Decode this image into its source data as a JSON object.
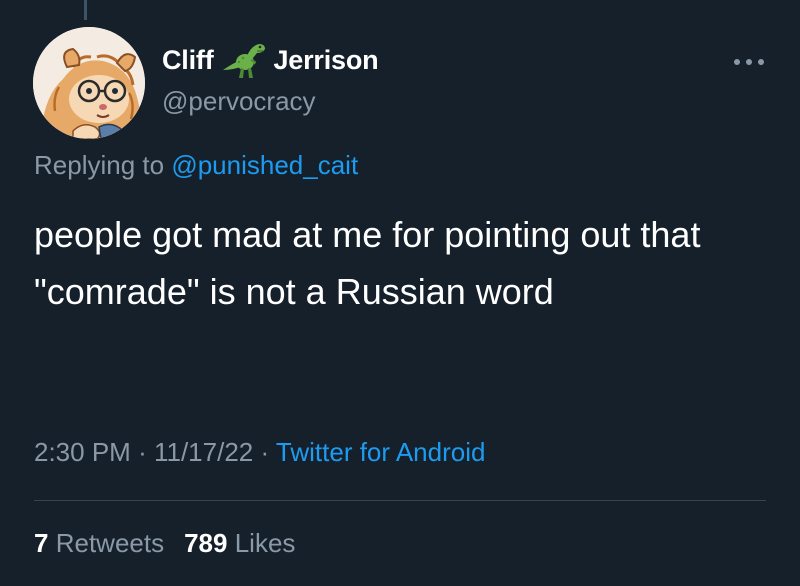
{
  "tweet": {
    "author": {
      "name_first": "Cliff",
      "name_last": "Jerrison",
      "name_emoji": "t-rex-icon",
      "handle": "@pervocracy",
      "avatar": "hamster-avatar-icon"
    },
    "more_icon": "more-horizontal-icon",
    "reply_prefix": "Replying to",
    "reply_to": "@punished_cait",
    "text": "people got mad at me for pointing out that \"comrade\" is not a Russian word",
    "time": "2:30 PM",
    "separator": "·",
    "date": "11/17/22",
    "source": "Twitter for Android",
    "retweets_count": "7",
    "retweets_label": "Retweets",
    "likes_count": "789",
    "likes_label": "Likes"
  },
  "colors": {
    "background": "#15202b",
    "text_primary": "#ffffff",
    "text_secondary": "#8b98a5",
    "accent": "#1d9bf0",
    "divider": "#38444d"
  }
}
